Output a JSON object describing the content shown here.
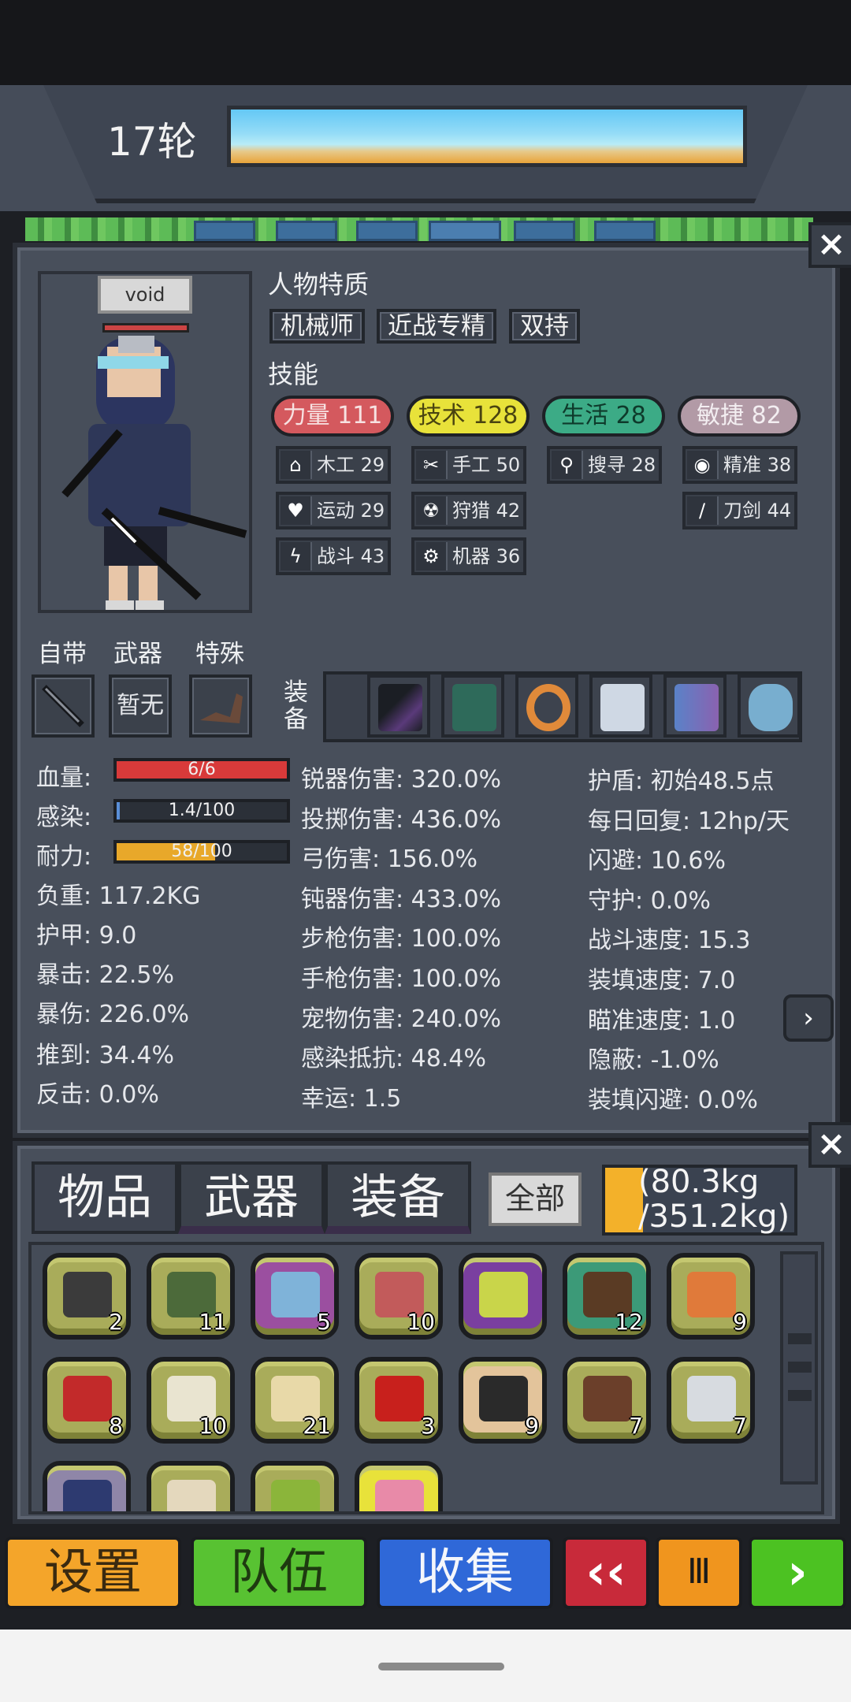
{
  "header": {
    "round": "17轮"
  },
  "character": {
    "name": "void",
    "traits_title": "人物特质",
    "traits": [
      "机械师",
      "近战专精",
      "双持"
    ],
    "skills_title": "技能",
    "main_skills": [
      {
        "label": "力量 111",
        "color": "#d4595e",
        "text": "#f7e2e2"
      },
      {
        "label": "技术 128",
        "color": "#e8e23a",
        "text": "#4a4410"
      },
      {
        "label": "生活 28",
        "color": "#3cab86",
        "text": "#0e3a2b"
      },
      {
        "label": "敏捷 82",
        "color": "#b29aa6",
        "text": "#f3eef1"
      }
    ],
    "sub_skills": [
      {
        "label": "木工 29",
        "icon": "house-icon",
        "glyph": "⌂"
      },
      {
        "label": "手工 50",
        "icon": "scissors-icon",
        "glyph": "✂"
      },
      {
        "label": "搜寻 28",
        "icon": "magnifier-icon",
        "glyph": "⚲"
      },
      {
        "label": "精准 38",
        "icon": "eye-icon",
        "glyph": "◉"
      },
      {
        "label": "运动 29",
        "icon": "heart-icon",
        "glyph": "♥"
      },
      {
        "label": "狩猎 42",
        "icon": "radiation-icon",
        "glyph": "☢"
      },
      {
        "label": "刀剑 44",
        "icon": "sword-icon",
        "glyph": "/"
      },
      {
        "label": "战斗 43",
        "icon": "lightning-icon",
        "glyph": "ϟ"
      },
      {
        "label": "机器 36",
        "icon": "gear-icon",
        "glyph": "⚙"
      }
    ],
    "slots": {
      "builtin": "自带",
      "weapon": "武器",
      "special": "特殊",
      "weapon_value": "暂无",
      "equip_label_1": "装",
      "equip_label_2": "备"
    }
  },
  "stats": {
    "col1": {
      "hp_label": "血量:",
      "hp_text": "6/6",
      "hp_fraction": 1.0,
      "infect_label": "感染:",
      "infect_text": "1.4/100",
      "infect_fraction": 0.014,
      "stamina_label": "耐力:",
      "stamina_text": "58/100",
      "stamina_fraction": 0.58,
      "load": "负重: 117.2KG",
      "armor": "护甲: 9.0",
      "crit": "暴击: 22.5%",
      "critdmg": "暴伤: 226.0%",
      "knock": "推到: 34.4%",
      "counter": "反击: 0.0%"
    },
    "col2": [
      "锐器伤害: 320.0%",
      "投掷伤害: 436.0%",
      "弓伤害: 156.0%",
      "钝器伤害: 433.0%",
      "步枪伤害: 100.0%",
      "手枪伤害: 100.0%",
      "宠物伤害: 240.0%",
      "感染抵抗: 48.4%",
      "幸运: 1.5"
    ],
    "col3": [
      "护盾: 初始48.5点",
      "每日回复: 12hp/天",
      "闪避: 10.6%",
      "守护: 0.0%",
      "战斗速度: 15.3",
      "装填速度: 7.0",
      "瞄准速度: 1.0",
      "隐蔽: -1.0%",
      "装填闪避: 0.0%"
    ]
  },
  "inventory": {
    "tabs": [
      "物品",
      "武器",
      "装备"
    ],
    "filter": "全部",
    "weight_line1": "(80.3kg",
    "weight_line2": "/351.2kg)",
    "weight_fraction": 0.229,
    "items": [
      {
        "name": "boots-icon",
        "count": "2",
        "bg": "#a9ac5a",
        "color": "#3b3b3b"
      },
      {
        "name": "herb-icon",
        "count": "11",
        "bg": "#a9ac5a",
        "color": "#4c6a3a"
      },
      {
        "name": "shirt-icon",
        "count": "5",
        "bg": "#9b4fa0",
        "color": "#7fb3d9"
      },
      {
        "name": "meat-can-icon",
        "count": "10",
        "bg": "#a9ac5a",
        "color": "#c25b5b"
      },
      {
        "name": "toxic-can-icon",
        "count": "",
        "bg": "#7a3fa0",
        "color": "#c9d54a"
      },
      {
        "name": "log-icon",
        "count": "12",
        "bg": "#3c9a78",
        "color": "#5a3b24"
      },
      {
        "name": "chair-icon",
        "count": "9",
        "bg": "#a9ac5a",
        "color": "#e07a3a"
      },
      {
        "name": "steak-icon",
        "count": "8",
        "bg": "#a9ac5a",
        "color": "#c22a2a"
      },
      {
        "name": "milk-bottle-icon",
        "count": "10",
        "bg": "#a9ac5a",
        "color": "#e9e4d0"
      },
      {
        "name": "supplies-icon",
        "count": "21",
        "bg": "#a9ac5a",
        "color": "#e8d9a8"
      },
      {
        "name": "chili-icon",
        "count": "3",
        "bg": "#a9ac5a",
        "color": "#c8201c"
      },
      {
        "name": "rope-icon",
        "count": "9",
        "bg": "#e3c49b",
        "color": "#2a2a2a"
      },
      {
        "name": "chocolate-icon",
        "count": "7",
        "bg": "#a9ac5a",
        "color": "#6b3f2a"
      },
      {
        "name": "cloth-icon",
        "count": "7",
        "bg": "#a9ac5a",
        "color": "#d7dbe0"
      },
      {
        "name": "knife-icon",
        "count": "",
        "bg": "#8f86a8",
        "color": "#2d3a70"
      },
      {
        "name": "egg-icon",
        "count": "",
        "bg": "#a9ac5a",
        "color": "#e4d8bd"
      },
      {
        "name": "apple-icon",
        "count": "",
        "bg": "#a9ac5a",
        "color": "#8bb53a"
      },
      {
        "name": "potion-icon",
        "count": "",
        "bg": "#e8e23a",
        "color": "#e88aa8"
      }
    ]
  },
  "nav": {
    "settings": "设置",
    "team": "队伍",
    "collect": "收集",
    "rewind": "‹‹",
    "pause": "Ⅲ",
    "forward": "›"
  }
}
